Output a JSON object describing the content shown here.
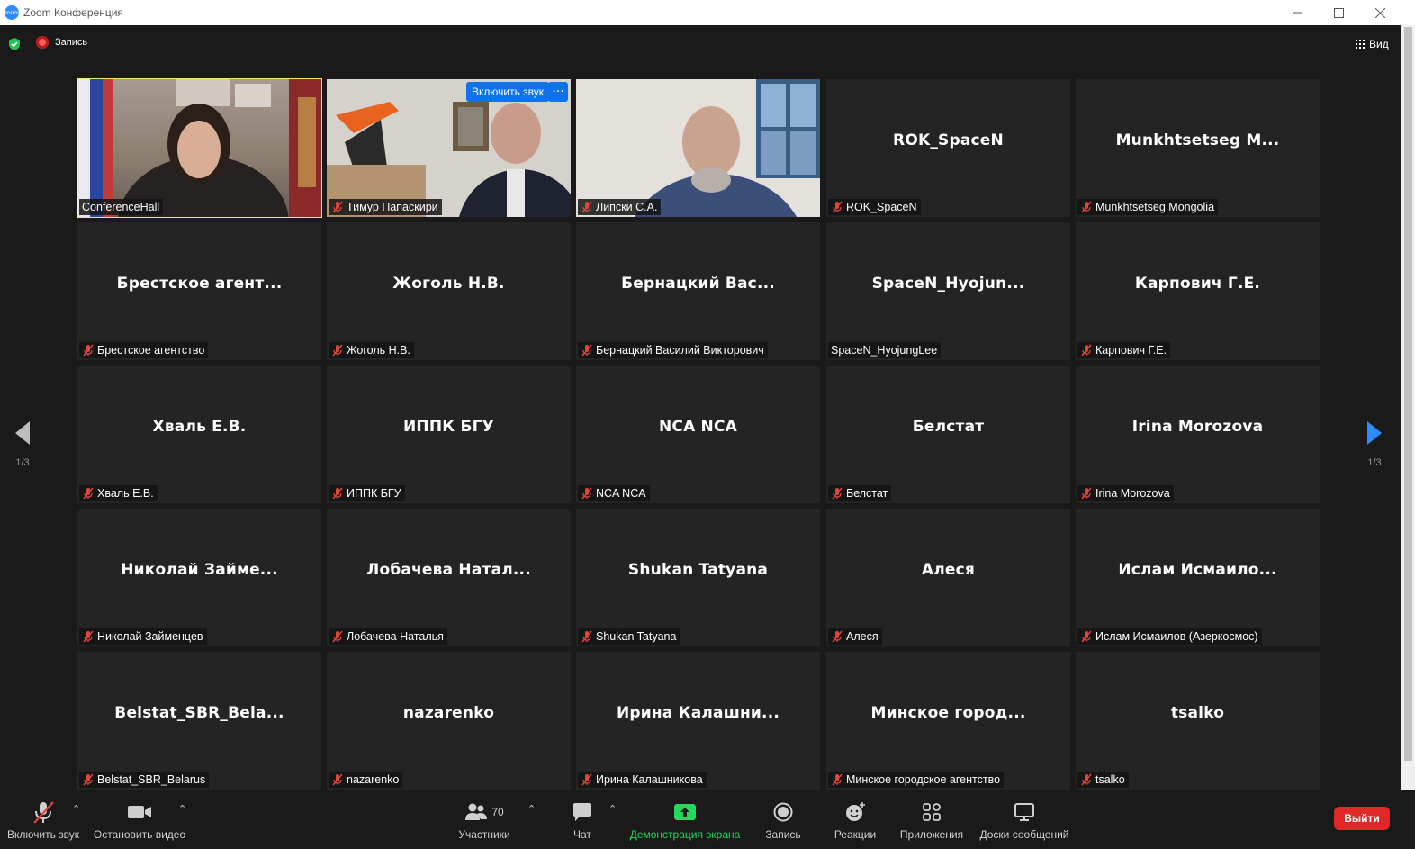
{
  "window": {
    "title": "Zoom Конференция",
    "logo_text": "zoom"
  },
  "topbar": {
    "recording_label": "Запись",
    "view_label": "Вид"
  },
  "pagination": {
    "left_page": "1/3",
    "right_page": "1/3"
  },
  "tiles": [
    {
      "big": "",
      "caption": "ConferenceHall",
      "muted": false,
      "video": "v1"
    },
    {
      "big": "",
      "caption": "Тимур Папаскири",
      "muted": true,
      "video": "v2",
      "unmute_label": "Включить звук",
      "more_label": "···"
    },
    {
      "big": "",
      "caption": "Липски С.А.",
      "muted": true,
      "video": "v3"
    },
    {
      "big": "ROK_SpaceN",
      "caption": "ROK_SpaceN",
      "muted": true
    },
    {
      "big": "Munkhtsetseg  M...",
      "caption": "Munkhtsetseg Mongolia",
      "muted": true
    },
    {
      "big": "Брестское  агент...",
      "caption": "Брестское агентство",
      "muted": true
    },
    {
      "big": "Жоголь Н.В.",
      "caption": "Жоголь Н.В.",
      "muted": true
    },
    {
      "big": "Бернацкий  Вас...",
      "caption": "Бернацкий Василий Викторович",
      "muted": true
    },
    {
      "big": "SpaceN_Hyojun...",
      "caption": "SpaceN_HyojungLee",
      "muted": false
    },
    {
      "big": "Карпович Г.Е.",
      "caption": "Карпович Г.Е.",
      "muted": true
    },
    {
      "big": "Хваль Е.В.",
      "caption": "Хваль Е.В.",
      "muted": true
    },
    {
      "big": "ИППК БГУ",
      "caption": "ИППК БГУ",
      "muted": true
    },
    {
      "big": "NCA NCA",
      "caption": "NCA NCA",
      "muted": true
    },
    {
      "big": "Белстат",
      "caption": "Белстат",
      "muted": true
    },
    {
      "big": "Irina Morozova",
      "caption": "Irina Morozova",
      "muted": true
    },
    {
      "big": "Николай  Займе...",
      "caption": "Николай Займенцев",
      "muted": true
    },
    {
      "big": "Лобачева  Натал...",
      "caption": "Лобачева Наталья",
      "muted": true
    },
    {
      "big": "Shukan Tatyana",
      "caption": "Shukan Tatyana",
      "muted": true
    },
    {
      "big": "Алеся",
      "caption": "Алеся",
      "muted": true
    },
    {
      "big": "Ислам  Исмаило...",
      "caption": "Ислам Исмаилов (Азеркосмос)",
      "muted": true
    },
    {
      "big": "Belstat_SBR_Bela...",
      "caption": "Belstat_SBR_Belarus",
      "muted": true
    },
    {
      "big": "nazarenko",
      "caption": "nazarenko",
      "muted": true
    },
    {
      "big": "Ирина  Калашни...",
      "caption": "Ирина Калашникова",
      "muted": true
    },
    {
      "big": "Минское  город...",
      "caption": "Минское городское агентство",
      "muted": true
    },
    {
      "big": "tsalko",
      "caption": "tsalko",
      "muted": true
    }
  ],
  "toolbar": {
    "unmute": "Включить звук",
    "stop_video": "Остановить видео",
    "participants": "Участники",
    "participants_count": "70",
    "chat": "Чат",
    "share_screen": "Демонстрация экрана",
    "record": "Запись",
    "reactions": "Реакции",
    "apps": "Приложения",
    "whiteboards": "Доски сообщений",
    "leave": "Выйти"
  },
  "colors": {
    "accent_blue": "#0e72ed",
    "share_green": "#23d959",
    "leave_red": "#e02828",
    "active_speaker": "#f2e96b"
  }
}
